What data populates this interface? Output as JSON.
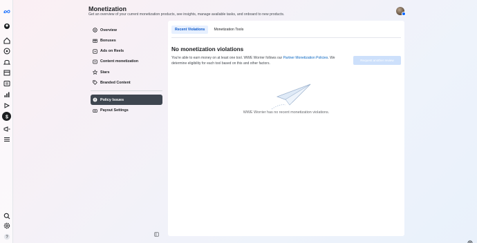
{
  "page": {
    "title": "Monetization",
    "subtitle": "Get an overview of your current monetization products, see insights, manage available tasks, and onboard to new products."
  },
  "rail": {
    "items": [
      {
        "icon": "meta-logo-icon"
      },
      {
        "icon": "profile-switch-icon"
      },
      {
        "icon": "home-icon"
      },
      {
        "icon": "notifications-icon"
      },
      {
        "icon": "content-icon"
      },
      {
        "icon": "calendar-icon"
      },
      {
        "icon": "inbox-icon"
      },
      {
        "icon": "insights-icon"
      },
      {
        "icon": "ads-icon"
      },
      {
        "icon": "monetization-icon"
      },
      {
        "icon": "megaphone-icon"
      },
      {
        "icon": "menu-icon"
      },
      {
        "icon": "search-icon"
      },
      {
        "icon": "settings-icon"
      },
      {
        "icon": "help-icon"
      }
    ]
  },
  "nav": {
    "items": [
      {
        "label": "Overview",
        "icon": "overview-icon",
        "active": false
      },
      {
        "label": "Bonuses",
        "icon": "bonuses-icon",
        "active": false
      },
      {
        "label": "Ads on Reels",
        "icon": "reels-icon",
        "active": false
      },
      {
        "label": "Content monetization",
        "icon": "content-monetization-icon",
        "active": false
      },
      {
        "label": "Stars",
        "icon": "stars-icon",
        "active": false
      },
      {
        "label": "Branded Content",
        "icon": "branded-content-icon",
        "active": false
      }
    ],
    "secondary": [
      {
        "label": "Policy Issues",
        "icon": "policy-icon",
        "active": true
      },
      {
        "label": "Payout Settings",
        "icon": "payout-icon",
        "active": false
      }
    ]
  },
  "tabs": [
    {
      "label": "Recent Violations",
      "active": true
    },
    {
      "label": "Monetization Tools",
      "active": false
    }
  ],
  "content": {
    "heading": "No monetization violations",
    "desc_before": "You're able to earn money on at least one tool. WWE Worrier follows our ",
    "desc_link": "Partner Monetization Policies",
    "desc_after": ". We determine eligibility for each tool based on this and other factors.",
    "request_button": "Request another review",
    "empty_message": "WWE Worrier has no recent monetization violations."
  },
  "colors": {
    "accent": "#0866ff",
    "active_nav": "#3e4650",
    "active_tab_bg": "#e7f0ff",
    "disabled_button": "#cde0fb"
  }
}
